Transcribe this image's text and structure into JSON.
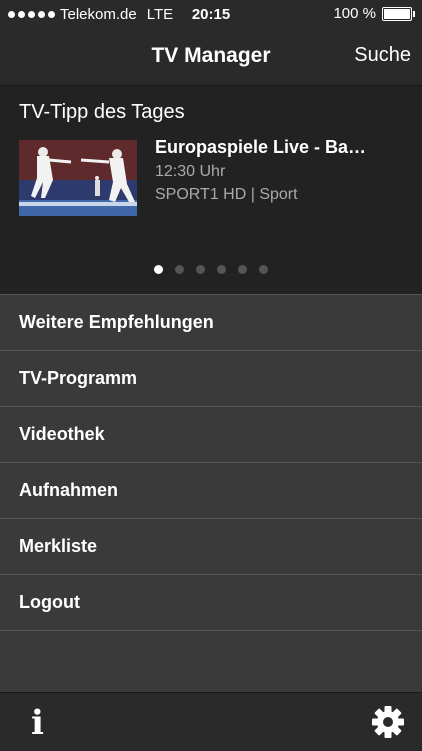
{
  "statusbar": {
    "carrier": "Telekom.de",
    "network": "LTE",
    "time": "20:15",
    "battery": "100 %"
  },
  "navbar": {
    "title": "TV Manager",
    "search_label": "Suche"
  },
  "tip": {
    "heading": "TV-Tipp des Tages",
    "title": "Europaspiele Live - Ba…",
    "time": "12:30 Uhr",
    "channel": "SPORT1 HD  |  Sport",
    "page_count": 6,
    "active_page": 1
  },
  "menu": {
    "items": [
      {
        "label": "Weitere Empfehlungen"
      },
      {
        "label": "TV-Programm"
      },
      {
        "label": "Videothek"
      },
      {
        "label": "Aufnahmen"
      },
      {
        "label": "Merkliste"
      },
      {
        "label": "Logout"
      }
    ]
  },
  "bottombar": {
    "info_icon": "i",
    "settings_icon": "gear-icon"
  },
  "colors": {
    "background": "#3a3a3a",
    "bar": "#2a2a2a",
    "tip_background": "#222222",
    "secondary_text": "#aaaaaa"
  }
}
